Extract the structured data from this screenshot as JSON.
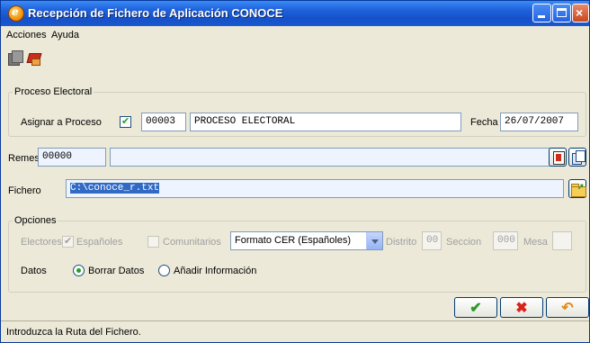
{
  "window": {
    "title": "Recepción de Fichero de Aplicación CONOCE",
    "app_icon_letter": "e"
  },
  "menu": {
    "acciones": "Acciones",
    "ayuda": "Ayuda"
  },
  "toolbar": {
    "icons": [
      "copy-icon",
      "export-icon"
    ]
  },
  "proceso_electoral": {
    "legend": "Proceso Electoral",
    "asignar_label": "Asignar a Proceso",
    "asignar_checked": true,
    "code": "00003",
    "name": "PROCESO ELECTORAL",
    "fecha_label": "Fecha",
    "fecha": "26/07/2007"
  },
  "remesa": {
    "label": "Remesa",
    "code": "00000",
    "value": ""
  },
  "fichero": {
    "label": "Fichero",
    "value": "C:\\conoce_r.txt"
  },
  "opciones": {
    "legend": "Opciones",
    "electores_label": "Electores",
    "espanoles_label": "Españoles",
    "espanoles_checked": true,
    "comunitarios_label": "Comunitarios",
    "comunitarios_checked": false,
    "formato_selected": "Formato CER (Españoles)",
    "distrito_label": "Distrito",
    "distrito_value": "00",
    "seccion_label": "Seccion",
    "seccion_value": "000",
    "mesa_label": "Mesa",
    "mesa_value": "",
    "datos_label": "Datos",
    "borrar_label": "Borrar Datos",
    "anadir_label": "Añadir Información",
    "datos_selected": "Borrar Datos"
  },
  "buttons": {
    "ok": "✔",
    "cancel": "✖",
    "undo": "↶"
  },
  "status": {
    "text": "Introduzca la Ruta del Fichero."
  },
  "colors": {
    "title_bar": "#1f62dc",
    "window_bg": "#ece9d8",
    "selection": "#316ac5"
  }
}
